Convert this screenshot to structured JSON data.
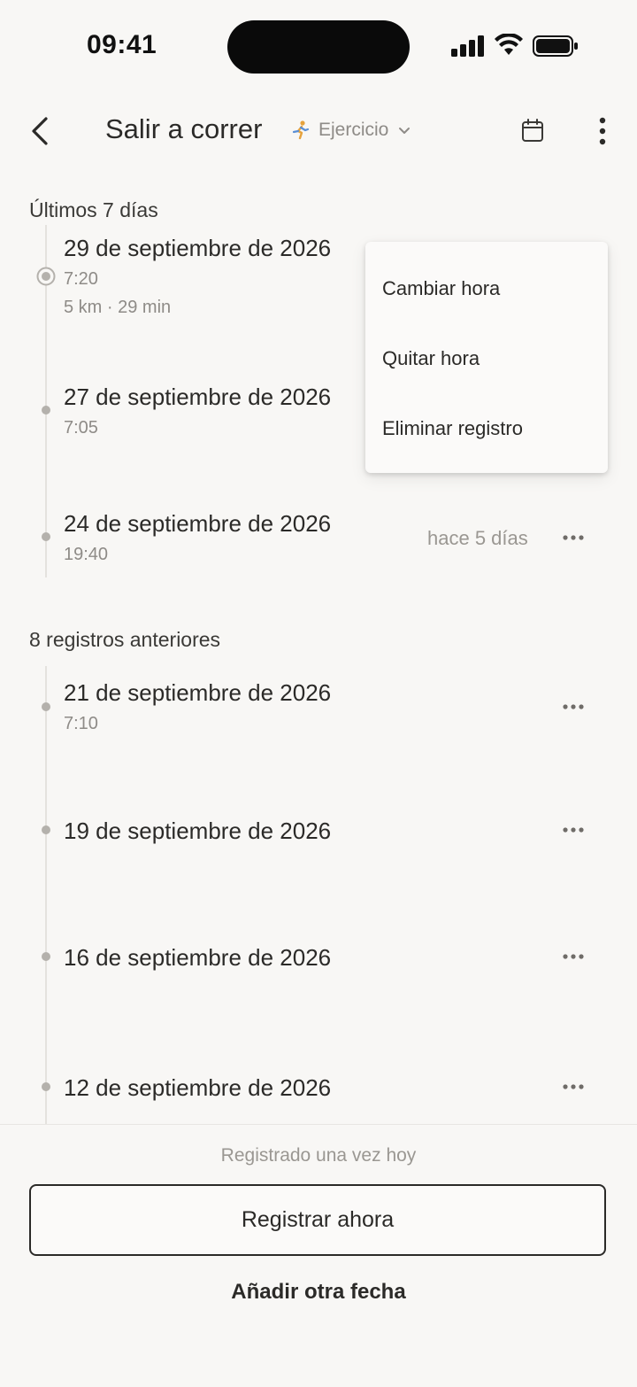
{
  "status_bar": {
    "time": "09:41"
  },
  "header": {
    "title": "Salir a correr",
    "category": "Ejercicio",
    "icons": {
      "back": "chevron-left-icon",
      "calendar": "calendar-icon",
      "more": "more-vertical-icon",
      "category": "runner-icon",
      "dropdown": "chevron-down-icon"
    }
  },
  "sections": {
    "recent": "Últimos 7 días",
    "older": "8 registros anteriores"
  },
  "entries": [
    {
      "date": "29 de septiembre de 2026",
      "time": "7:20",
      "detail": "5 km · 29 min",
      "selected": true
    },
    {
      "date": "27 de septiembre de 2026",
      "time": "7:05"
    },
    {
      "date": "24 de septiembre de 2026",
      "time": "19:40",
      "relative": "hace 5 días"
    },
    {
      "date": "21 de septiembre de 2026",
      "time": "7:10"
    },
    {
      "date": "19 de septiembre de 2026"
    },
    {
      "date": "16 de septiembre de 2026"
    },
    {
      "date": "12 de septiembre de 2026"
    }
  ],
  "context_menu": {
    "items": [
      "Cambiar hora",
      "Quitar hora",
      "Eliminar registro"
    ]
  },
  "footer": {
    "status": "Registrado una vez hoy",
    "primary_button": "Registrar ahora",
    "secondary_button": "Añadir otra fecha"
  },
  "colors": {
    "background": "#f8f7f5",
    "text": "#2b2a28",
    "muted": "#8e8b87",
    "timeline_dot": "#b4b1ac"
  }
}
